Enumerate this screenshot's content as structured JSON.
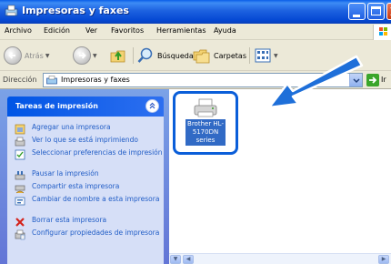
{
  "window": {
    "title": "Impresoras y faxes"
  },
  "menubar": {
    "items": [
      "Archivo",
      "Edición",
      "Ver",
      "Favoritos",
      "Herramientas",
      "Ayuda"
    ]
  },
  "toolbar": {
    "back_label": "Atrás",
    "search_label": "Búsqueda",
    "folders_label": "Carpetas"
  },
  "address": {
    "label": "Dirección",
    "value": "Impresoras y faxes",
    "go_label": "Ir"
  },
  "tasks": {
    "title": "Tareas de impresión",
    "items": [
      {
        "label": "Agregar una impresora",
        "icon": "add-printer-icon"
      },
      {
        "label": "Ver lo que se está imprimiendo",
        "icon": "print-queue-icon"
      },
      {
        "label": "Seleccionar preferencias de impresión",
        "icon": "preferences-icon"
      },
      {
        "label": "Pausar la impresión",
        "icon": "pause-icon"
      },
      {
        "label": "Compartir esta impresora",
        "icon": "share-printer-icon"
      },
      {
        "label": "Cambiar de nombre a esta impresora",
        "icon": "rename-icon"
      },
      {
        "label": "Borrar esta impresora",
        "icon": "delete-icon"
      },
      {
        "label": "Configurar propiedades de impresora",
        "icon": "properties-icon"
      }
    ]
  },
  "printers": [
    {
      "name": "Brother HL-5170DN series"
    }
  ],
  "colors": {
    "titlebar": "#0548d3",
    "task_link": "#215dc6",
    "selection": "#316ac5",
    "highlight_ring": "#0a5ed9",
    "arrow": "#1e6fd9"
  }
}
